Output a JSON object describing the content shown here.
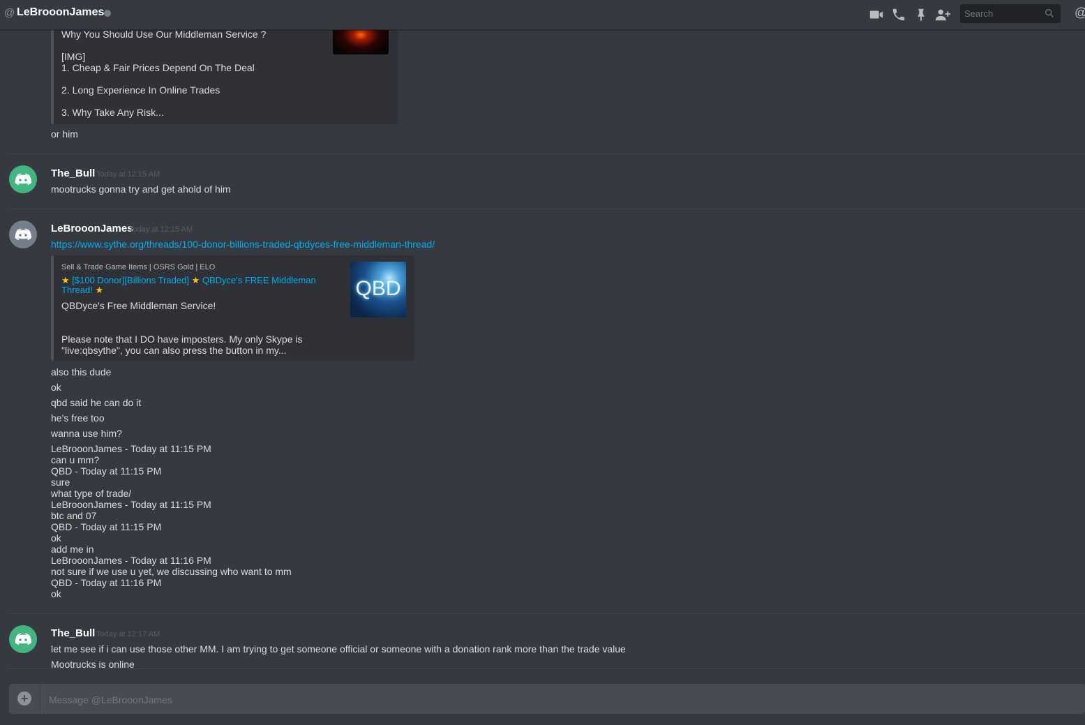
{
  "header": {
    "at_symbol": "@",
    "channel_name": "LeBrooonJames",
    "search_placeholder": "Search",
    "mention_symbol": "@",
    "icons": [
      "video-icon",
      "phone-icon",
      "pin-icon",
      "add-friend-icon",
      "search-icon"
    ]
  },
  "messages": {
    "top_embed_lines": [
      "Why You Should Use Our Middleman Service ?",
      "[IMG]",
      "1. Cheap & Fair Prices Depend On The Deal",
      "2. Long Experience In Online Trades",
      "3. Why Take Any Risk..."
    ],
    "top_followup": "or him",
    "group1": {
      "author": "The_Bull",
      "timestamp": "Today at 12:15 AM",
      "lines": [
        "mootrucks gonna try and get ahold of him"
      ]
    },
    "group2": {
      "author": "LeBrooonJames",
      "timestamp": "Today at 12:15 AM",
      "link": "https://www.sythe.org/threads/100-donor-billions-traded-qbdyces-free-middleman-thread/",
      "embed": {
        "provider": "Sell & Trade Game Items | OSRS Gold | ELO",
        "title_part1": "[$100 Donor][Billions Traded]",
        "title_part2": "QBDyce's FREE Middleman Thread!",
        "star": "★",
        "desc1": "QBDyce's Free Middleman Service!",
        "desc2": "Please note that I DO have imposters. My only Skype is",
        "desc3": "\"live:qbsythe\", you can also press the button in my...",
        "thumb_text": "QBD"
      },
      "lines": [
        "also this dude",
        "ok",
        "qbd said he can do it",
        "he's free too",
        "wanna use him?"
      ],
      "pasted": [
        "LeBrooonJames - Today at 11:15 PM",
        "can u mm?",
        "QBD - Today at 11:15 PM",
        "sure",
        "what type of trade/",
        "LeBrooonJames - Today at 11:15 PM",
        "btc and 07",
        "QBD - Today at 11:15 PM",
        "ok",
        "add me in",
        "LeBrooonJames - Today at 11:16 PM",
        "not sure if we use u yet, we discussing who want to mm",
        "QBD - Today at 11:16 PM",
        "ok"
      ]
    },
    "group3": {
      "author": "The_Bull",
      "timestamp": "Today at 12:17 AM",
      "lines": [
        "let me see if i can use those other MM. I am trying to get someone official or someone with a donation rank more than the trade value",
        "Mootrucks is online"
      ]
    }
  },
  "composer": {
    "placeholder": "Message @LeBrooonJames",
    "add_symbol": "+"
  },
  "colors": {
    "background": "#36393f",
    "avatar_green": "#43b581",
    "avatar_grey": "#747f8d",
    "link": "#00b0f4"
  }
}
